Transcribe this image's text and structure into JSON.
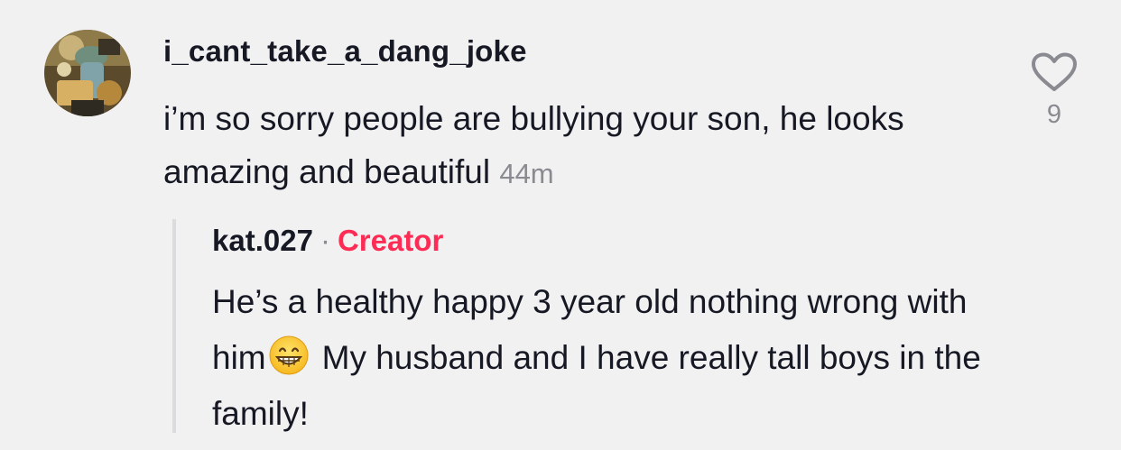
{
  "comment": {
    "username": "i_cant_take_a_dang_joke",
    "text": "i’m so sorry people are bullying your son, he looks amazing and beautiful",
    "time": "44m",
    "likes": "9",
    "icons": {
      "avatar": "user-avatar",
      "like": "heart-outline-icon"
    }
  },
  "reply": {
    "username": "kat.027",
    "separator": "·",
    "badge": "Creator",
    "text_part1": "He’s a healthy happy 3 year old nothing wrong with him",
    "emoji": "grinning-face-emoji",
    "text_part2": "My husband and I have really tall boys in the family!"
  },
  "colors": {
    "background": "#f1f1f2",
    "text": "#161823",
    "muted": "#8a8b91",
    "creator": "#fe2c55"
  }
}
